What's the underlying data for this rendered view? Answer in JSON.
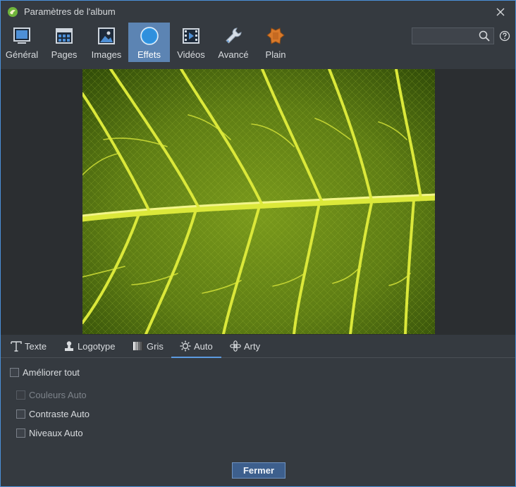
{
  "window": {
    "title": "Paramètres de l'album"
  },
  "toolbar": {
    "items": [
      {
        "label": "Général",
        "icon": "general-icon"
      },
      {
        "label": "Pages",
        "icon": "pages-icon"
      },
      {
        "label": "Images",
        "icon": "images-icon"
      },
      {
        "label": "Effets",
        "icon": "effects-icon",
        "active": true
      },
      {
        "label": "Vidéos",
        "icon": "videos-icon"
      },
      {
        "label": "Avancé",
        "icon": "wrench-icon"
      },
      {
        "label": "Plain",
        "icon": "plain-icon"
      }
    ],
    "search": {
      "value": "",
      "placeholder": ""
    }
  },
  "tabs": [
    {
      "label": "Texte",
      "icon": "text-icon"
    },
    {
      "label": "Logotype",
      "icon": "logo-stamp-icon"
    },
    {
      "label": "Gris",
      "icon": "gradient-icon"
    },
    {
      "label": "Auto",
      "icon": "sun-icon",
      "active": true
    },
    {
      "label": "Arty",
      "icon": "flower-icon"
    }
  ],
  "auto": {
    "improve_all": {
      "label": "Améliorer tout",
      "checked": false
    },
    "auto_colors": {
      "label": "Couleurs Auto",
      "checked": false,
      "enabled": false
    },
    "auto_contrast": {
      "label": "Contraste Auto",
      "checked": false
    },
    "auto_levels": {
      "label": "Niveaux Auto",
      "checked": false
    }
  },
  "footer": {
    "close_label": "Fermer"
  },
  "colors": {
    "accent": "#5c84b3",
    "button": "#3d5f8d",
    "background": "#353a40",
    "preview_bg": "#2b2e31"
  }
}
